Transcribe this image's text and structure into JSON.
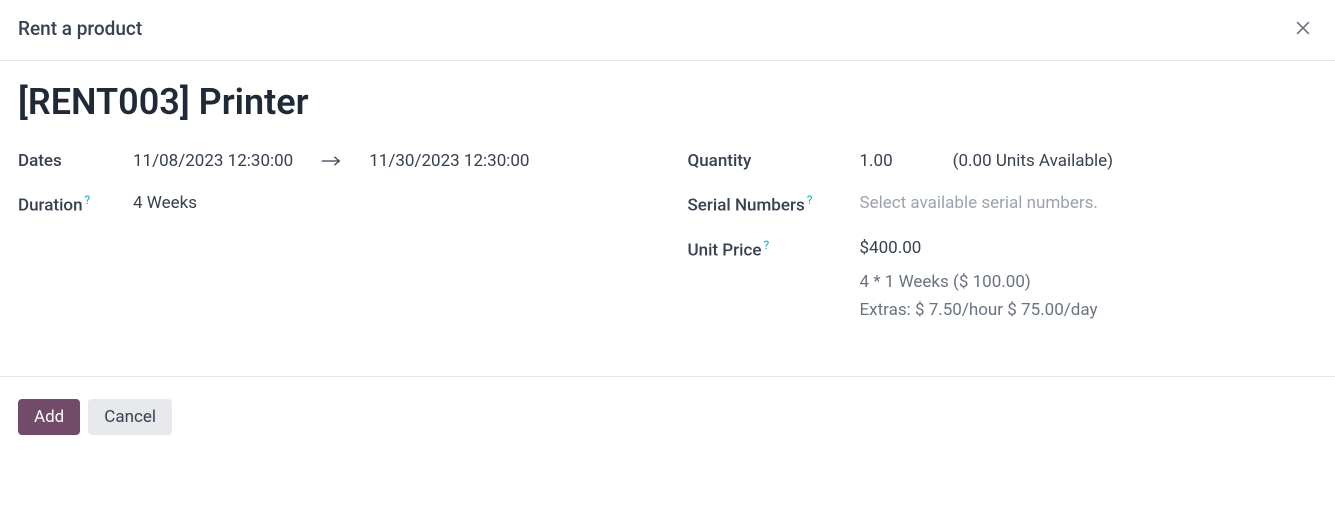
{
  "modal_title": "Rent a product",
  "product_title": "[RENT003] Printer",
  "labels": {
    "dates": "Dates",
    "duration": "Duration",
    "quantity": "Quantity",
    "serial_numbers": "Serial Numbers",
    "unit_price": "Unit Price"
  },
  "dates": {
    "start": "11/08/2023 12:30:00",
    "end": "11/30/2023 12:30:00"
  },
  "duration": "4 Weeks",
  "quantity": {
    "value": "1.00",
    "availability": "(0.00 Units Available)"
  },
  "serial_numbers_placeholder": "Select available serial numbers.",
  "unit_price": {
    "amount": "$400.00",
    "breakdown": "4 * 1 Weeks ($ 100.00)",
    "extras": "Extras: $ 7.50/hour $ 75.00/day"
  },
  "buttons": {
    "add": "Add",
    "cancel": "Cancel"
  },
  "help_marker": "?"
}
